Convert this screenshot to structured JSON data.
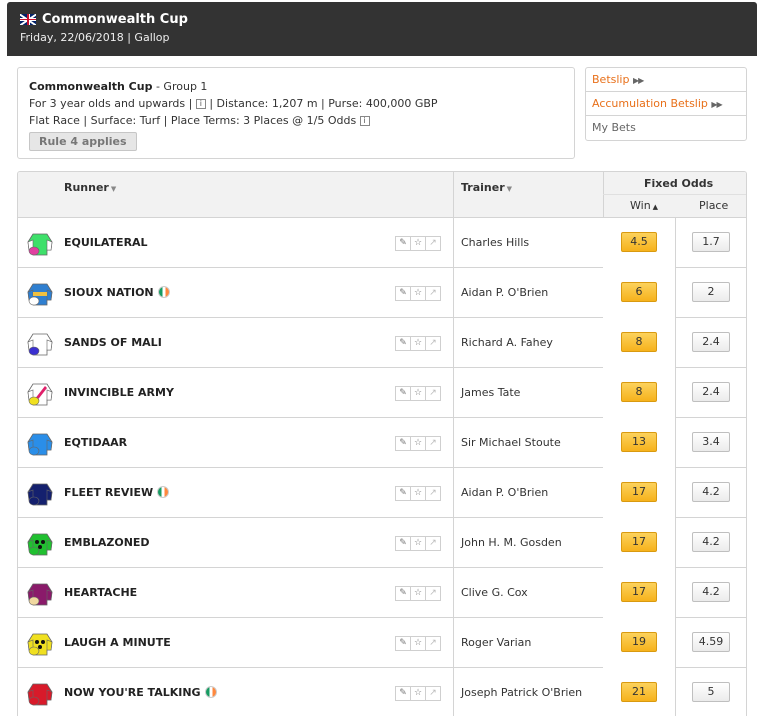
{
  "header": {
    "title": "Commonwealth Cup",
    "subtitle": "Friday, 22/06/2018  |  Gallop"
  },
  "race": {
    "name": "Commonwealth Cup",
    "group": " - Group 1",
    "line1_left": "For 3 year olds and upwards  |  ",
    "line1_right": "  |  Distance: 1,207 m  |  Purse: 400,000 GBP",
    "line2": "Flat Race  |  Surface: Turf  |  Place Terms: 3 Places @ 1/5 Odds ",
    "rule_button": "Rule 4 applies"
  },
  "sidebar": {
    "betslip": "Betslip",
    "accumulation": "Accumulation Betslip",
    "my_bets": "My Bets"
  },
  "table": {
    "col_runner": "Runner",
    "col_trainer": "Trainer",
    "col_fixed_odds": "Fixed Odds",
    "col_win": "Win",
    "col_place": "Place"
  },
  "runners": [
    {
      "name": "EQUILATERAL",
      "irish": false,
      "trainer": "Charles Hills",
      "win": "4.5",
      "place": "1.7",
      "silk": {
        "body": "#3ee06a",
        "sleeve": "#ffffff",
        "cap": "#e040a0",
        "pattern": "none"
      }
    },
    {
      "name": "SIOUX NATION",
      "irish": true,
      "trainer": "Aidan P. O'Brien",
      "win": "6",
      "place": "2",
      "silk": {
        "body": "#2f7fd0",
        "sleeve": "#2f7fd0",
        "cap": "#ffffff",
        "pattern": "hoop"
      }
    },
    {
      "name": "SANDS OF MALI",
      "irish": false,
      "trainer": "Richard A. Fahey",
      "win": "8",
      "place": "2.4",
      "silk": {
        "body": "#ffffff",
        "sleeve": "#ffffff",
        "cap": "#3a2fd0",
        "pattern": "none"
      }
    },
    {
      "name": "INVINCIBLE ARMY",
      "irish": false,
      "trainer": "James Tate",
      "win": "8",
      "place": "2.4",
      "silk": {
        "body": "#ffffff",
        "sleeve": "#ffffff",
        "cap": "#f0e020",
        "pattern": "sash"
      }
    },
    {
      "name": "EQTIDAAR",
      "irish": false,
      "trainer": "Sir Michael Stoute",
      "win": "13",
      "place": "3.4",
      "silk": {
        "body": "#2a8ee8",
        "sleeve": "#2a8ee8",
        "cap": "#2a8ee8",
        "pattern": "none"
      }
    },
    {
      "name": "FLEET REVIEW",
      "irish": true,
      "trainer": "Aidan P. O'Brien",
      "win": "17",
      "place": "4.2",
      "silk": {
        "body": "#14206e",
        "sleeve": "#14206e",
        "cap": "#14206e",
        "pattern": "none"
      }
    },
    {
      "name": "EMBLAZONED",
      "irish": false,
      "trainer": "John H. M. Gosden",
      "win": "17",
      "place": "4.2",
      "silk": {
        "body": "#20c030",
        "sleeve": "#20c030",
        "cap": "#20c030",
        "pattern": "dots"
      }
    },
    {
      "name": "HEARTACHE",
      "irish": false,
      "trainer": "Clive G. Cox",
      "win": "17",
      "place": "4.2",
      "silk": {
        "body": "#8a1a6a",
        "sleeve": "#8a1a6a",
        "cap": "#f0d8a0",
        "pattern": "none"
      }
    },
    {
      "name": "LAUGH A MINUTE",
      "irish": false,
      "trainer": "Roger Varian",
      "win": "19",
      "place": "4.59",
      "silk": {
        "body": "#f0e020",
        "sleeve": "#f0e020",
        "cap": "#f0e020",
        "pattern": "dots"
      }
    },
    {
      "name": "NOW YOU'RE TALKING",
      "irish": true,
      "trainer": "Joseph Patrick O'Brien",
      "win": "21",
      "place": "5",
      "silk": {
        "body": "#d81a2a",
        "sleeve": "#d81a2a",
        "cap": "#d81a2a",
        "pattern": "none"
      }
    }
  ],
  "icons": {
    "flag": "uk-flag-icon",
    "info": "info-icon",
    "tools": [
      "pencil-icon",
      "star-icon",
      "chart-icon"
    ]
  }
}
